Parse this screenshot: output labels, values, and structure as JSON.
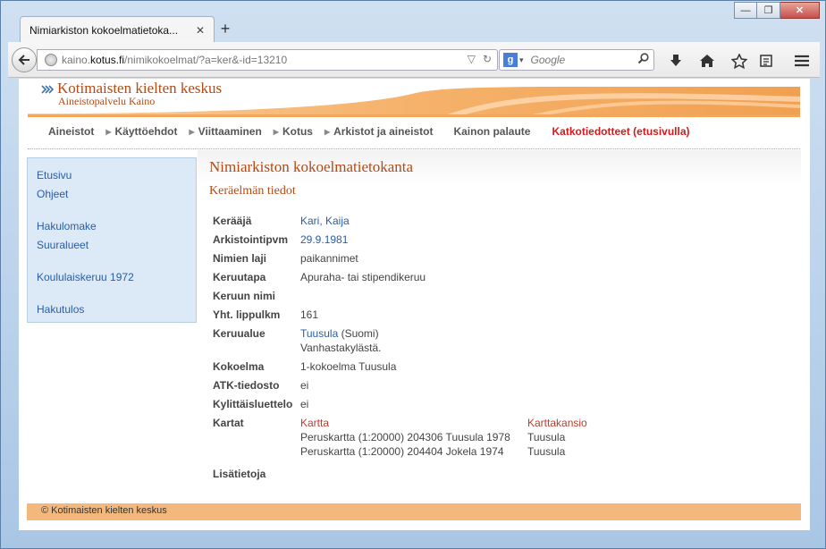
{
  "browser": {
    "tab_title": "Nimiarkiston kokoelmatietoka...",
    "tab_close": "✕",
    "new_tab": "+",
    "url_prefix": "kaino.",
    "url_host": "kotus.fi",
    "url_path": "/nimikokoelmat/?a=ker&-id=13210",
    "search_placeholder": "Google",
    "search_engine_icon": "g",
    "window_controls": [
      "—",
      "❐",
      "✕"
    ]
  },
  "site": {
    "title": "Kotimaisten kielten keskus",
    "subtitle": "Aineistopalvelu Kaino"
  },
  "nav": {
    "items": [
      "Aineistot",
      "Käyttöehdot",
      "Viittaaminen",
      "Kotus",
      "Arkistot ja aineistot",
      "Kainon palaute"
    ],
    "highlight": "Katkotiedotteet (etusivulla)"
  },
  "sidebar": {
    "group1": [
      "Etusivu",
      "Ohjeet"
    ],
    "group2": [
      "Hakulomake",
      "Suuralueet"
    ],
    "group3": [
      "Koululaiskeruu 1972"
    ],
    "group4": [
      "Hakutulos"
    ]
  },
  "main": {
    "heading": "Nimiarkiston kokoelmatietokanta",
    "subheading": "Keräelmän tiedot",
    "rows": {
      "keraaja": {
        "label": "Kerääjä",
        "value": "Kari, Kaija"
      },
      "arkistointipvm": {
        "label": "Arkistointipvm",
        "value": "29.9.1981"
      },
      "nimien_laji": {
        "label": "Nimien laji",
        "value": "paikannimet"
      },
      "keruutapa": {
        "label": "Keruutapa",
        "value": "Apuraha- tai stipendikeruu"
      },
      "keruun_nimi": {
        "label": "Keruun nimi",
        "value": ""
      },
      "lippulkm": {
        "label": "Yht. lippulkm",
        "value": "161"
      },
      "keruualue": {
        "label": "Keruualue",
        "link": "Tuusula",
        "suffix": " (Suomi)",
        "line2": "Vanhastakylästä."
      },
      "kokoelma": {
        "label": "Kokoelma",
        "value": "1-kokoelma Tuusula"
      },
      "atk": {
        "label": "ATK-tiedosto",
        "value": "ei"
      },
      "kylittais": {
        "label": "Kylittäisluettelo",
        "value": "ei"
      },
      "kartat": {
        "label": "Kartat",
        "col1_header": "Kartta",
        "col2_header": "Karttakansio",
        "maps": [
          {
            "kartta": "Peruskartta (1:20000) 204306 Tuusula 1978",
            "kansio": "Tuusula"
          },
          {
            "kartta": "Peruskartta (1:20000) 204404 Jokela 1974",
            "kansio": "Tuusula"
          }
        ]
      },
      "lisatietoja": {
        "label": "Lisätietoja",
        "value": ""
      }
    }
  },
  "footer": {
    "text": "© Kotimaisten kielten keskus"
  }
}
